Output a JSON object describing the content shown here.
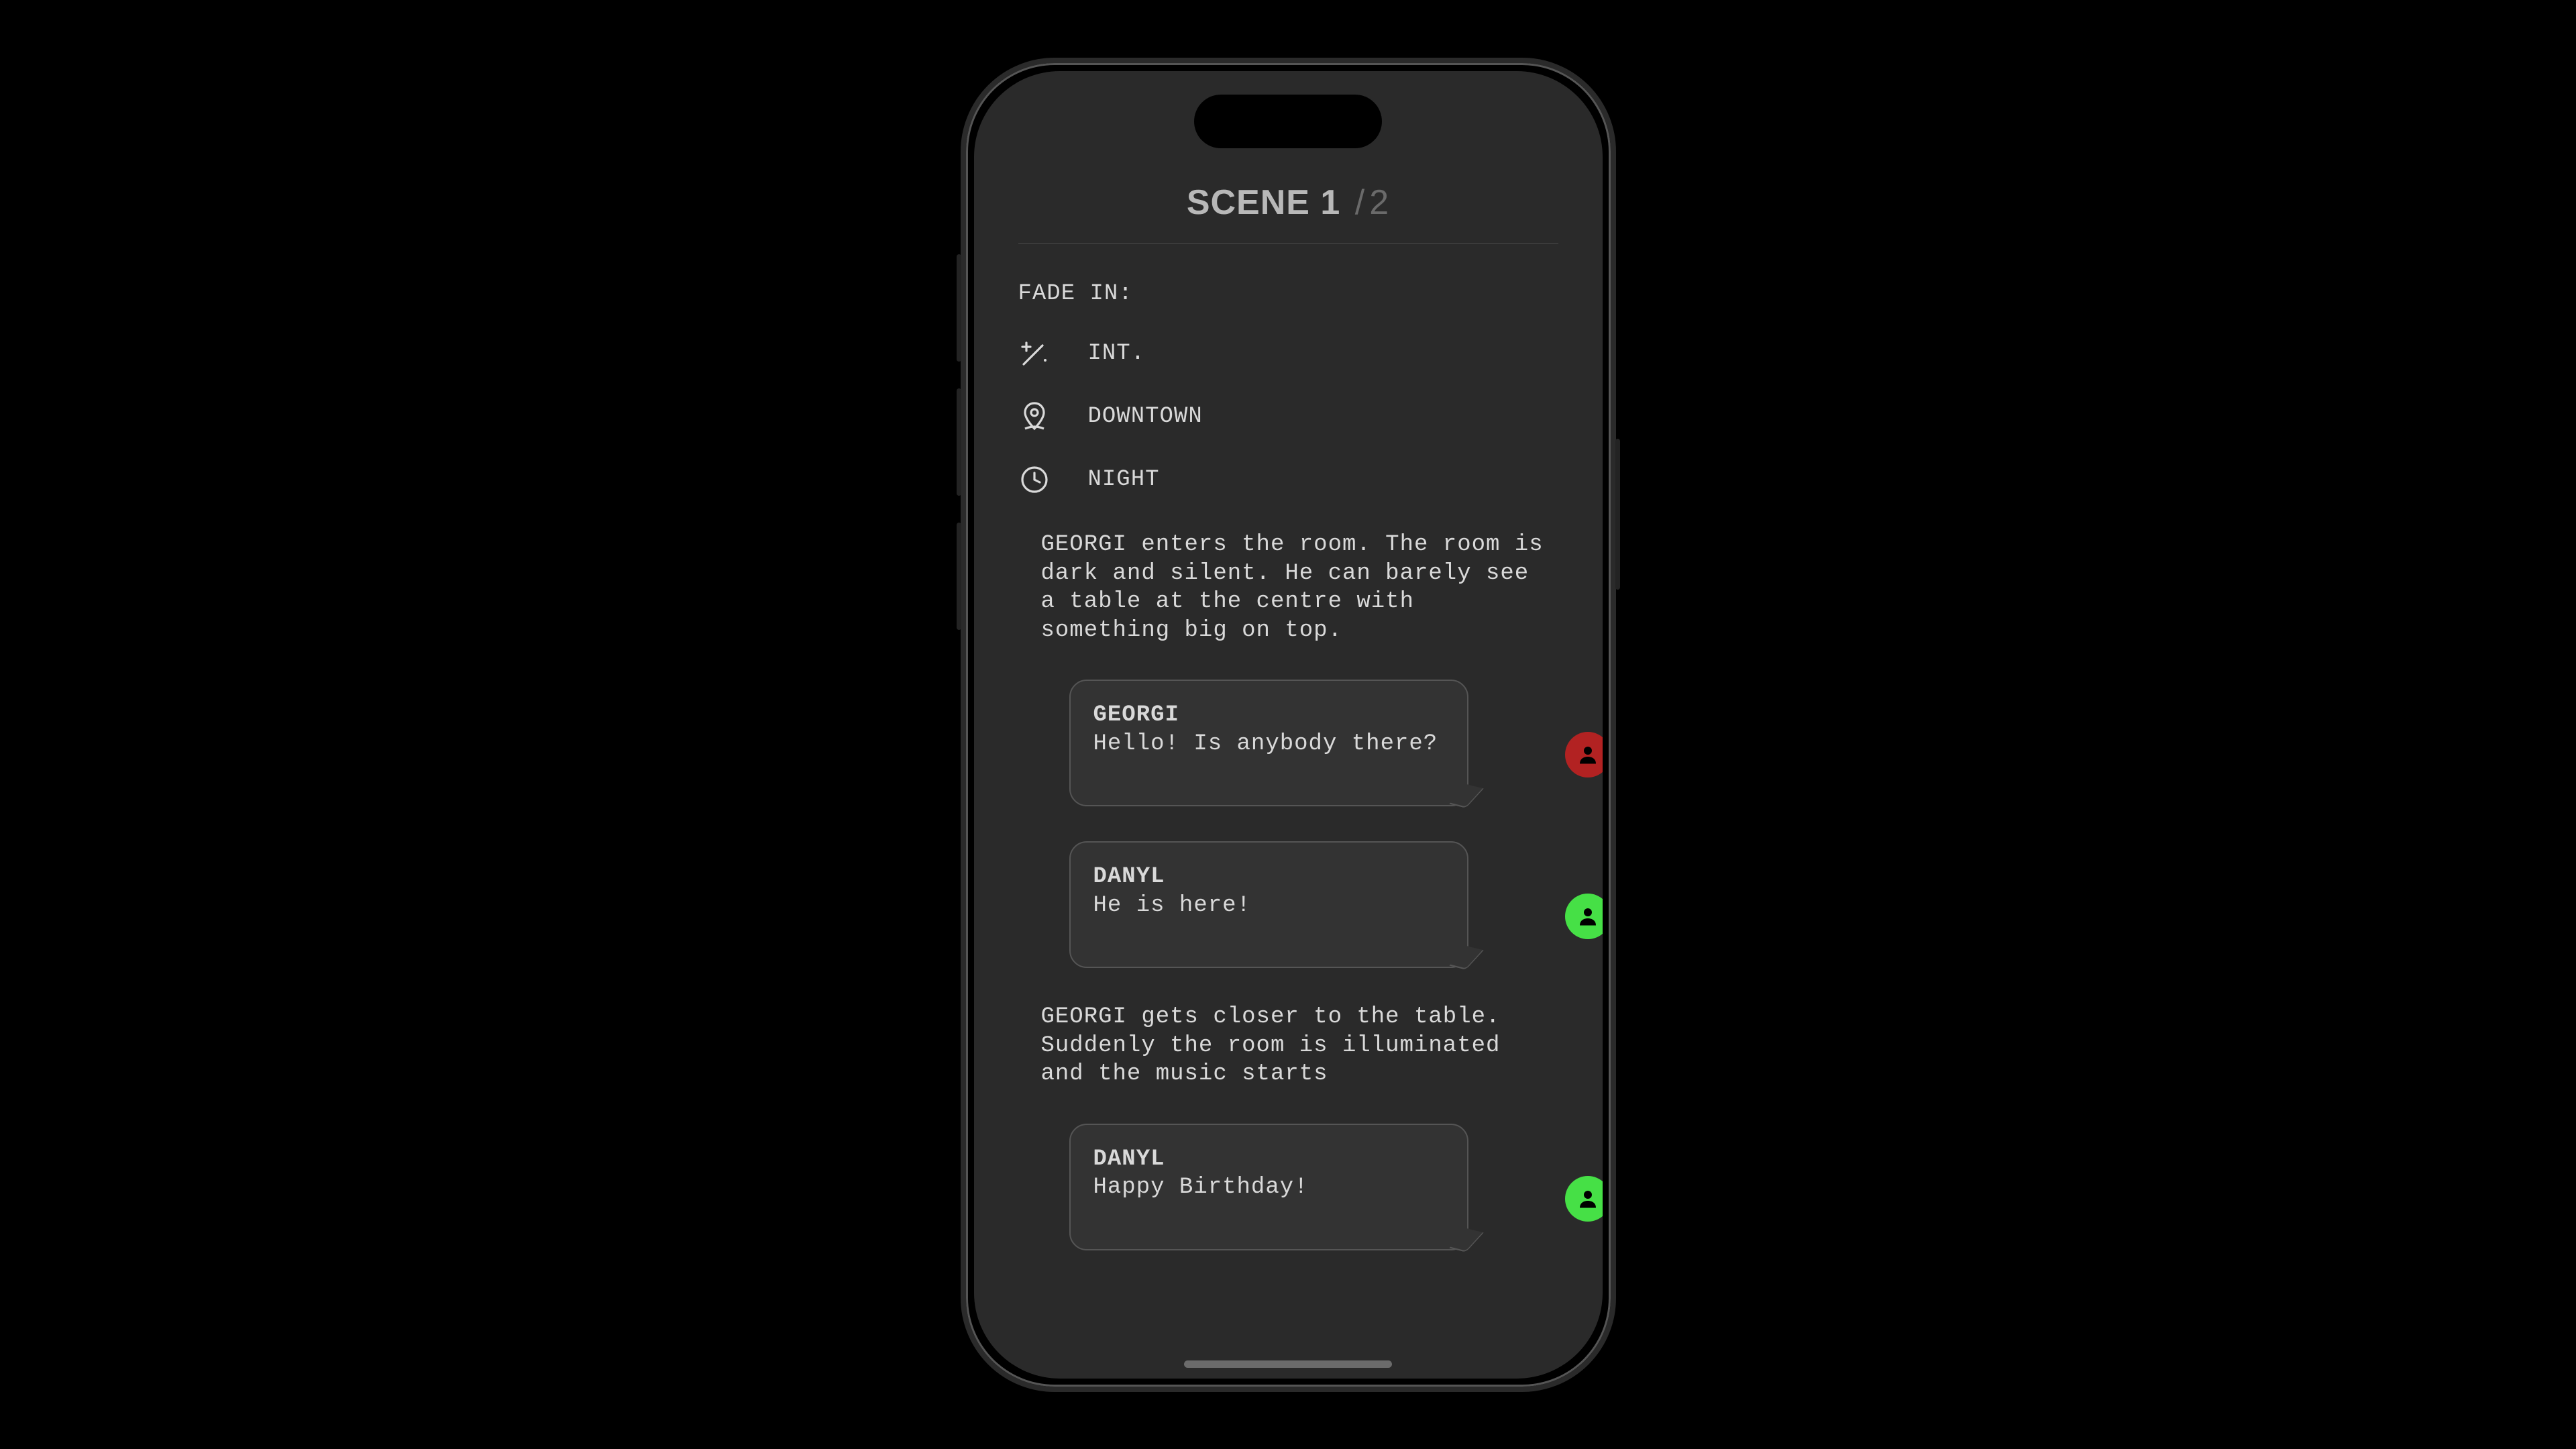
{
  "header": {
    "scene_label": "SCENE",
    "current": "1",
    "separator": "/",
    "total": "2"
  },
  "script": {
    "fade_in": "FADE IN:",
    "meta": {
      "setting": "INT.",
      "location": "DOWNTOWN",
      "time": "NIGHT"
    },
    "blocks": [
      {
        "type": "action",
        "text": "GEORGI enters the room. The room is dark and silent. He can barely see a table at the centre with something big on top."
      },
      {
        "type": "dialogue",
        "character": "GEORGI",
        "line": "Hello! Is anybody there?",
        "avatar_color": "red"
      },
      {
        "type": "dialogue",
        "character": "DANYL",
        "line": "He is here!",
        "avatar_color": "green"
      },
      {
        "type": "action",
        "text": "GEORGI gets closer to the table. Suddenly the room is illuminated and the music starts"
      },
      {
        "type": "dialogue",
        "character": "DANYL",
        "line": "Happy Birthday!",
        "avatar_color": "green"
      }
    ]
  },
  "icons": {
    "setting": "magic-wand-icon",
    "location": "location-pin-icon",
    "time": "clock-icon",
    "avatar": "person-icon"
  }
}
